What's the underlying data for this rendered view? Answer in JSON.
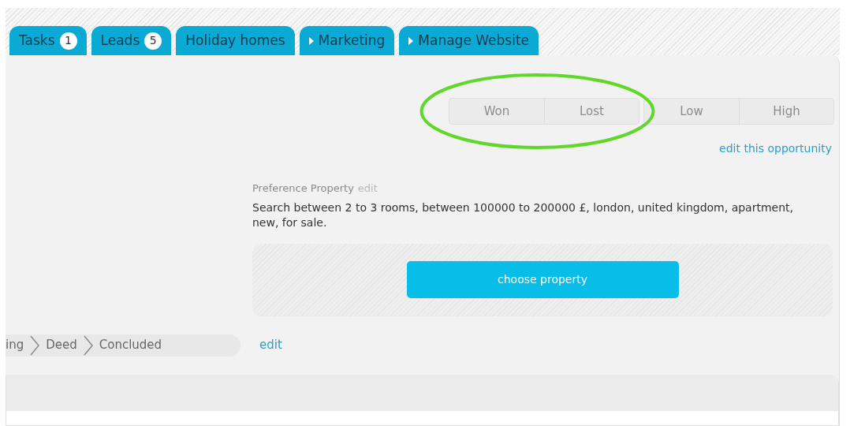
{
  "tabs": [
    {
      "label": "Tasks",
      "badge": "1",
      "kind": "plain"
    },
    {
      "label": "Leads",
      "badge": "5",
      "kind": "plain"
    },
    {
      "label": "Holiday homes",
      "kind": "plain"
    },
    {
      "label": "Marketing",
      "kind": "menu"
    },
    {
      "label": "Manage Website",
      "kind": "menu"
    }
  ],
  "status_buttons": [
    [
      "Won",
      "Lost"
    ],
    [
      "Low",
      "High"
    ]
  ],
  "edit_opportunity": "edit this opportunity",
  "preference": {
    "title": "Preference Property",
    "edit": "edit",
    "description": "Search between 2 to 3 rooms, between 100000 to 200000 £, london, united kingdom, apartment, new, for sale.",
    "button": "choose property"
  },
  "stages": [
    "ing",
    "Deed",
    "Concluded"
  ],
  "stages_edit": "edit"
}
